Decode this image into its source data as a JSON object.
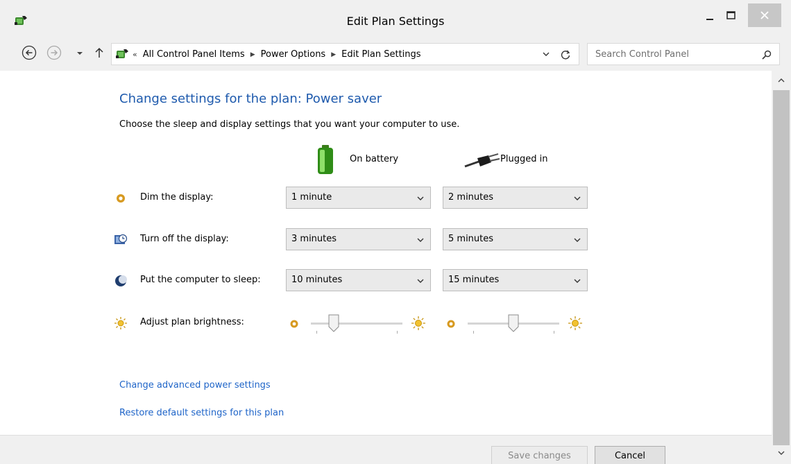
{
  "window": {
    "title": "Edit Plan Settings"
  },
  "address": {
    "crumbs": [
      "All Control Panel Items",
      "Power Options",
      "Edit Plan Settings"
    ],
    "overflow_chevron": "«"
  },
  "search": {
    "placeholder": "Search Control Panel"
  },
  "page": {
    "heading": "Change settings for the plan: Power saver",
    "subheading": "Choose the sleep and display settings that you want your computer to use."
  },
  "columns": {
    "battery": "On battery",
    "plugged": "Plugged in"
  },
  "rows": {
    "dim": {
      "label": "Dim the display:",
      "battery": "1 minute",
      "plugged": "2 minutes"
    },
    "turn_off": {
      "label": "Turn off the display:",
      "battery": "3 minutes",
      "plugged": "5 minutes"
    },
    "sleep": {
      "label": "Put the computer to sleep:",
      "battery": "10 minutes",
      "plugged": "15 minutes"
    },
    "brightness": {
      "label": "Adjust plan brightness:",
      "battery_level": 0.25,
      "plugged_level": 0.5
    }
  },
  "links": {
    "advanced": "Change advanced power settings",
    "restore": "Restore default settings for this plan"
  },
  "buttons": {
    "save": "Save changes",
    "cancel": "Cancel"
  },
  "colors": {
    "heading": "#1e5aad",
    "link": "#1e64c8",
    "chrome": "#f0f0f0"
  },
  "icons": [
    "power-options-icon",
    "back-icon",
    "forward-icon",
    "up-icon",
    "refresh-icon",
    "search-icon",
    "battery-icon",
    "plug-icon",
    "dim-display-icon",
    "turn-off-display-icon",
    "sleep-icon",
    "brightness-icon"
  ]
}
